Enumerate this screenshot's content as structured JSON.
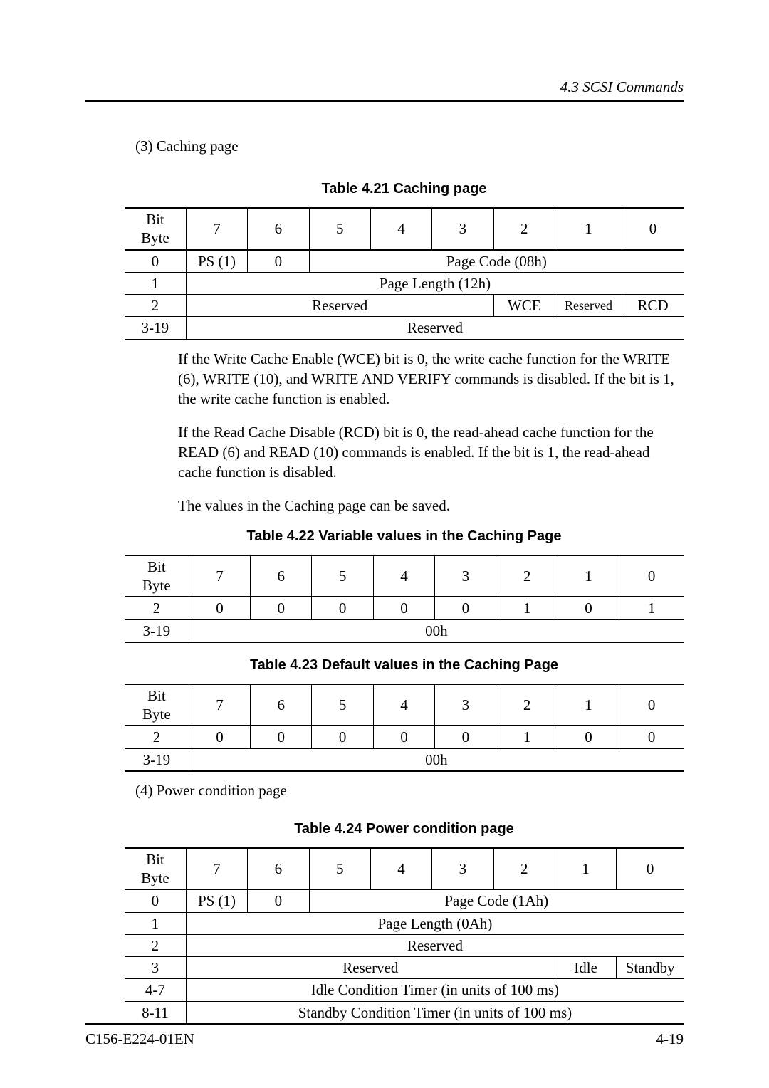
{
  "header": {
    "section": "4.3  SCSI Commands"
  },
  "sec3": {
    "label": "(3)  Caching page"
  },
  "t421": {
    "caption": "Table 4.21  Caching page",
    "hdr": {
      "corner": "Bit\nByte",
      "b7": "7",
      "b6": "6",
      "b5": "5",
      "b4": "4",
      "b3": "3",
      "b2": "2",
      "b1": "1",
      "b0": "0"
    },
    "r0": {
      "byte": "0",
      "ps": "PS (1)",
      "zero": "0",
      "code": "Page Code (08h)"
    },
    "r1": {
      "byte": "1",
      "len": "Page Length (12h)"
    },
    "r2": {
      "byte": "2",
      "res": "Reserved",
      "wce": "WCE",
      "res2": "Reserved",
      "rcd": "RCD"
    },
    "r3": {
      "byte": "3-19",
      "res": "Reserved"
    }
  },
  "para": {
    "p1": "If the Write Cache Enable (WCE) bit is 0, the write cache function for the WRITE (6), WRITE (10), and WRITE AND VERIFY commands is disabled.  If the bit is 1, the write cache function is enabled.",
    "p2": "If the Read Cache Disable (RCD) bit is 0, the read-ahead cache function for the READ (6) and READ (10) commands is enabled.  If the bit is 1, the read-ahead cache function is disabled.",
    "p3": "The values in the Caching page can be saved."
  },
  "t422": {
    "caption": "Table 4.22  Variable values in the Caching Page",
    "hdr": {
      "corner": "Bit\nByte",
      "b7": "7",
      "b6": "6",
      "b5": "5",
      "b4": "4",
      "b3": "3",
      "b2": "2",
      "b1": "1",
      "b0": "0"
    },
    "r2": {
      "byte": "2",
      "v7": "0",
      "v6": "0",
      "v5": "0",
      "v4": "0",
      "v3": "0",
      "v2": "1",
      "v1": "0",
      "v0": "1"
    },
    "r3": {
      "byte": "3-19",
      "val": "00h"
    }
  },
  "t423": {
    "caption": "Table 4.23  Default values in the Caching Page",
    "hdr": {
      "corner": "Bit\nByte",
      "b7": "7",
      "b6": "6",
      "b5": "5",
      "b4": "4",
      "b3": "3",
      "b2": "2",
      "b1": "1",
      "b0": "0"
    },
    "r2": {
      "byte": "2",
      "v7": "0",
      "v6": "0",
      "v5": "0",
      "v4": "0",
      "v3": "0",
      "v2": "1",
      "v1": "0",
      "v0": "0"
    },
    "r3": {
      "byte": "3-19",
      "val": "00h"
    }
  },
  "sec4": {
    "label": "(4)  Power condition page"
  },
  "t424": {
    "caption": "Table 4.24  Power condition page",
    "hdr": {
      "corner": "Bit\nByte",
      "b7": "7",
      "b6": "6",
      "b5": "5",
      "b4": "4",
      "b3": "3",
      "b2": "2",
      "b1": "1",
      "b0": "0"
    },
    "r0": {
      "byte": "0",
      "ps": "PS (1)",
      "zero": "0",
      "code": "Page Code (1Ah)"
    },
    "r1": {
      "byte": "1",
      "len": "Page Length (0Ah)"
    },
    "r2": {
      "byte": "2",
      "res": "Reserved"
    },
    "r3": {
      "byte": "3",
      "res": "Reserved",
      "idle": "Idle",
      "standby": "Standby"
    },
    "r4": {
      "byte": "4-7",
      "val": "Idle Condition Timer (in units of 100 ms)"
    },
    "r5": {
      "byte": "8-11",
      "val": "Standby Condition Timer (in units of 100 ms)"
    }
  },
  "footer": {
    "doc": "C156-E224-01EN",
    "page": "4-19"
  }
}
